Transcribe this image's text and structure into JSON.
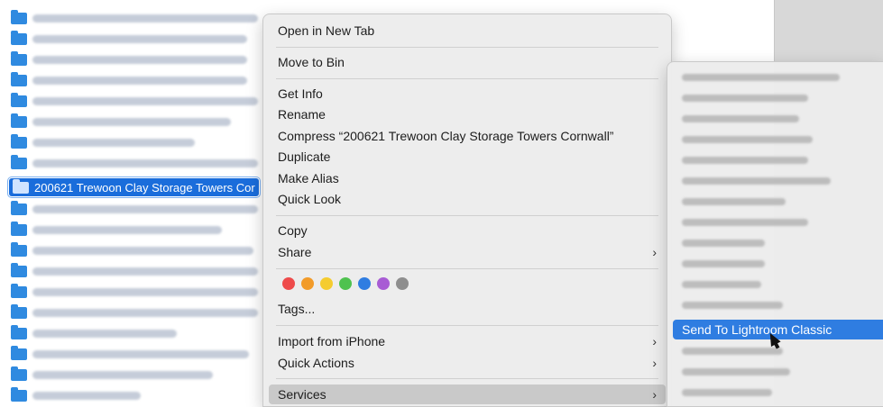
{
  "finder": {
    "selected_row_label": "200621 Trewoon Clay Storage Towers Cor",
    "rows_blurred": 20
  },
  "context_menu": {
    "items": [
      {
        "label": "Open in New Tab"
      },
      {
        "label": "Move to Bin"
      },
      {
        "label": "Get Info"
      },
      {
        "label": "Rename"
      },
      {
        "label": "Compress “200621 Trewoon Clay Storage Towers Cornwall”"
      },
      {
        "label": "Duplicate"
      },
      {
        "label": "Make Alias"
      },
      {
        "label": "Quick Look"
      },
      {
        "label": "Copy"
      },
      {
        "label": "Share"
      },
      {
        "label": "Tags..."
      },
      {
        "label": "Import from iPhone"
      },
      {
        "label": "Quick Actions"
      },
      {
        "label": "Services"
      }
    ],
    "tag_colors": [
      "#ee4b4b",
      "#f29b29",
      "#f5cc2f",
      "#4fc24f",
      "#2f7de1",
      "#a85cd4",
      "#8e8e8e"
    ]
  },
  "services_submenu": {
    "active_label": "Send To Lightroom Classic"
  },
  "colors": {
    "selection_blue": "#1a6ddb",
    "menu_bg": "#ececec",
    "submenu_highlight": "#2f7de1"
  }
}
